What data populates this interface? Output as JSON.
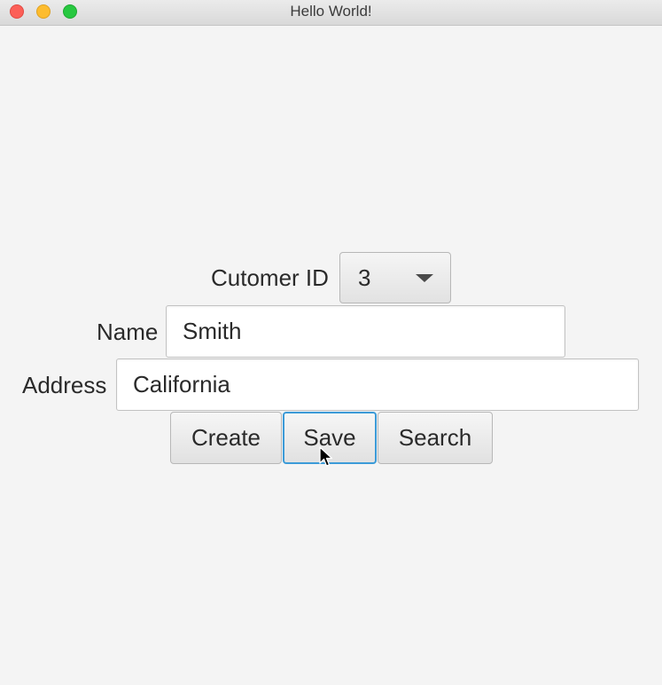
{
  "window": {
    "title": "Hello World!"
  },
  "form": {
    "customer_id_label": "Cutomer ID",
    "customer_id_value": "3",
    "name_label": "Name",
    "name_value": "Smith",
    "address_label": "Address",
    "address_value": "California"
  },
  "buttons": {
    "create": "Create",
    "save": "Save",
    "search": "Search"
  },
  "icons": {
    "dropdown": "chevron-down-icon",
    "cursor": "mouse-pointer-icon"
  },
  "colors": {
    "close": "#fc5f57",
    "minimize": "#fdbc2e",
    "zoom": "#27c840",
    "focus_ring": "#3c9bd8"
  }
}
